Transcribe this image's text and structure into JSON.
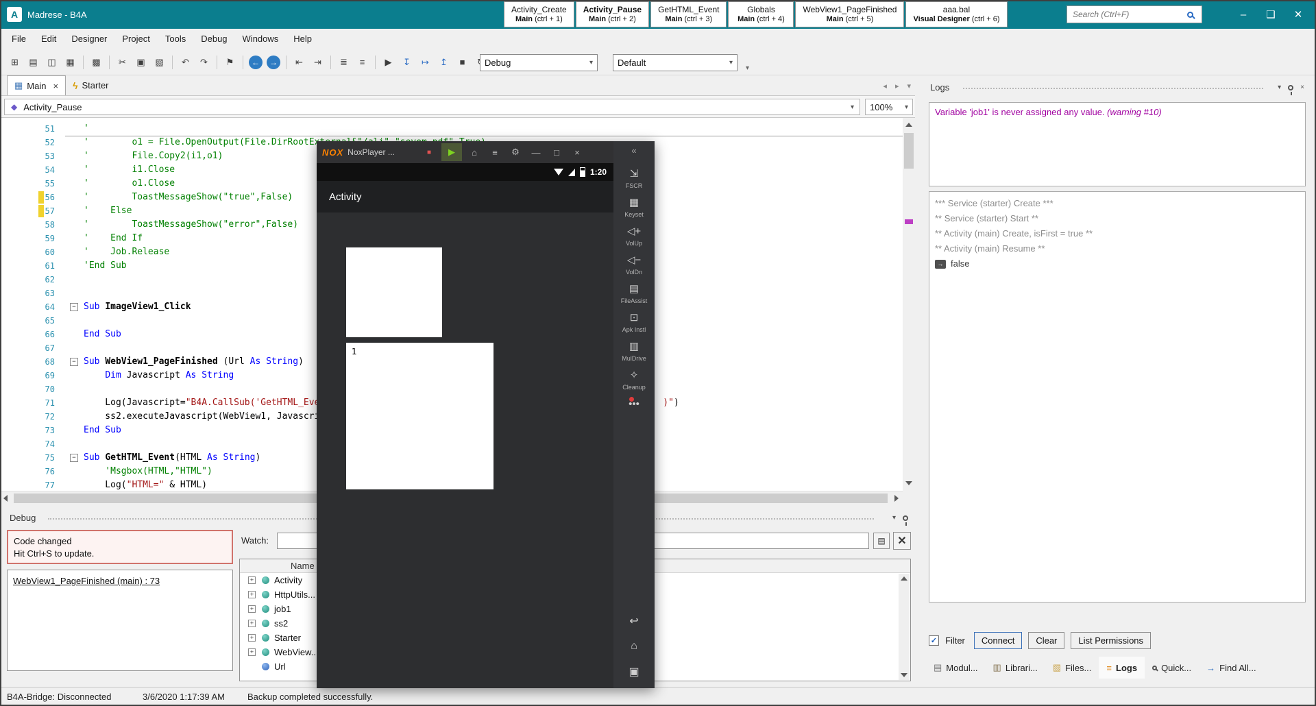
{
  "ui": {
    "collapse_glyph": "▾",
    "close_glyph": "×",
    "check_glyph": "✓",
    "expander_glyph": "+",
    "fold_glyph": "−",
    "return_icon_glyph": "→"
  },
  "app": {
    "title": "Madrese - B4A",
    "logo_letter": "A",
    "accent_color": "#0b7e8e"
  },
  "titlebar": {
    "search_placeholder": "Search (Ctrl+F)",
    "quick_tabs": [
      {
        "title": "Activity_Create",
        "module": "Main",
        "shortcut": "(ctrl + 1)",
        "active": false
      },
      {
        "title": "Activity_Pause",
        "module": "Main",
        "shortcut": "(ctrl + 2)",
        "active": true
      },
      {
        "title": "GetHTML_Event",
        "module": "Main",
        "shortcut": "(ctrl + 3)",
        "active": false
      },
      {
        "title": "Globals",
        "module": "Main",
        "shortcut": "(ctrl + 4)",
        "active": false
      },
      {
        "title": "WebView1_PageFinished",
        "module": "Main",
        "shortcut": "(ctrl + 5)",
        "active": false
      },
      {
        "title": "aaa.bal",
        "module": "Visual Designer",
        "shortcut": "(ctrl + 6)",
        "active": false
      }
    ],
    "window_buttons": [
      {
        "glyph": "–",
        "name": "minimize-button"
      },
      {
        "glyph": "❑",
        "name": "maximize-button"
      },
      {
        "glyph": "✕",
        "name": "close-button"
      }
    ]
  },
  "menubar": [
    "File",
    "Edit",
    "Designer",
    "Project",
    "Tools",
    "Debug",
    "Windows",
    "Help"
  ],
  "toolbar": {
    "debug_mode": "Debug",
    "build_config": "Default",
    "buttons": [
      {
        "glyph": "⊞",
        "name": "new-button"
      },
      {
        "glyph": "▤",
        "name": "open-button"
      },
      {
        "glyph": "◫",
        "name": "save-button"
      },
      {
        "glyph": "▦",
        "name": "save-all-button"
      },
      {
        "sep": true
      },
      {
        "glyph": "▩",
        "name": "designer-button"
      },
      {
        "sep": true
      },
      {
        "glyph": "✂",
        "name": "cut-button"
      },
      {
        "glyph": "▣",
        "name": "copy-button"
      },
      {
        "glyph": "▧",
        "name": "paste-button"
      },
      {
        "sep": true
      },
      {
        "glyph": "↶",
        "name": "undo-button"
      },
      {
        "glyph": "↷",
        "name": "redo-button"
      },
      {
        "sep": true
      },
      {
        "glyph": "⚑",
        "name": "bookmark-button"
      },
      {
        "sep": true
      },
      {
        "glyph": "←",
        "name": "navigate-back-button",
        "style": "circle"
      },
      {
        "glyph": "→",
        "name": "navigate-forward-button",
        "style": "circle"
      },
      {
        "sep": true
      },
      {
        "glyph": "⇤",
        "name": "outdent-button"
      },
      {
        "glyph": "⇥",
        "name": "indent-button"
      },
      {
        "sep": true
      },
      {
        "glyph": "≣",
        "name": "comment-button"
      },
      {
        "glyph": "≡",
        "name": "uncomment-button"
      },
      {
        "sep": true
      },
      {
        "glyph": "▶",
        "name": "run-button"
      },
      {
        "glyph": "↧",
        "name": "step-into-button",
        "style": "blue"
      },
      {
        "glyph": "↦",
        "name": "step-over-button",
        "style": "blue"
      },
      {
        "glyph": "↥",
        "name": "step-out-button",
        "style": "blue"
      },
      {
        "glyph": "■",
        "name": "stop-button"
      },
      {
        "glyph": "↻",
        "name": "restart-button"
      },
      {
        "sep": true
      }
    ]
  },
  "doc_tabs": [
    {
      "label": "Main",
      "active": true,
      "icon_glyph": "▦",
      "icon_class": "grid",
      "icon_name": "module-grid-icon",
      "closable": true
    },
    {
      "label": "Starter",
      "active": false,
      "icon_glyph": "ϟ",
      "icon_class": "bolt",
      "icon_name": "service-lightning-icon",
      "closable": false
    }
  ],
  "doc_tab_nav": [
    {
      "glyph": "◂",
      "name": "tabs-scroll-left"
    },
    {
      "glyph": "▸",
      "name": "tabs-scroll-right"
    },
    {
      "glyph": "▾",
      "name": "tabs-list-dropdown"
    }
  ],
  "module_bar": {
    "selected_sub": "Activity_Pause",
    "zoom": "100%",
    "icon_glyph": "◆"
  },
  "code": {
    "lines": [
      {
        "n": 51,
        "segs": [
          [
            "'",
            "c"
          ]
        ]
      },
      {
        "n": 52,
        "div": true,
        "segs": [
          [
            "'        o1 = File.OpenOutput(File.DirRootExternal&\"/ali\",\"sevom.pdf\",True)",
            "c"
          ]
        ]
      },
      {
        "n": 53,
        "segs": [
          [
            "'        File.Copy2(i1,o1)",
            "c"
          ]
        ]
      },
      {
        "n": 54,
        "segs": [
          [
            "'        i1.Close",
            "c"
          ]
        ]
      },
      {
        "n": 55,
        "segs": [
          [
            "'        o1.Close",
            "c"
          ]
        ]
      },
      {
        "n": 56,
        "mark": true,
        "segs": [
          [
            "'        ToastMessageShow(\"true\",False)",
            "c"
          ]
        ]
      },
      {
        "n": 57,
        "mark": true,
        "segs": [
          [
            "'    Else",
            "c"
          ]
        ]
      },
      {
        "n": 58,
        "segs": [
          [
            "'        ToastMessageShow(\"error\",False)",
            "c"
          ]
        ]
      },
      {
        "n": 59,
        "segs": [
          [
            "'    End If",
            "c"
          ]
        ]
      },
      {
        "n": 60,
        "segs": [
          [
            "'    Job.Release",
            "c"
          ]
        ]
      },
      {
        "n": 61,
        "segs": [
          [
            "'End Sub",
            "c"
          ]
        ]
      },
      {
        "n": 62,
        "segs": []
      },
      {
        "n": 63,
        "segs": []
      },
      {
        "n": 64,
        "fold": true,
        "segs": [
          [
            "Sub ",
            "k"
          ],
          [
            "ImageView1_Click",
            "b"
          ]
        ]
      },
      {
        "n": 65,
        "segs": []
      },
      {
        "n": 66,
        "segs": [
          [
            "End Sub",
            "k"
          ]
        ]
      },
      {
        "n": 67,
        "segs": []
      },
      {
        "n": 68,
        "fold": true,
        "segs": [
          [
            "Sub ",
            "k"
          ],
          [
            "WebView1_PageFinished ",
            "b"
          ],
          [
            "(Url ",
            "p"
          ],
          [
            "As String",
            "k"
          ],
          [
            ")",
            "p"
          ]
        ]
      },
      {
        "n": 69,
        "segs": [
          [
            "    ",
            "p"
          ],
          [
            "Dim ",
            "k"
          ],
          [
            "Javascript ",
            "p"
          ],
          [
            "As String",
            "k"
          ]
        ]
      },
      {
        "n": 70,
        "segs": []
      },
      {
        "n": 71,
        "segs": [
          [
            "    Log(Javascript=",
            "p"
          ],
          [
            "\"B4A.CallSub('GetHTML_Eve",
            "s"
          ],
          [
            "                                                                ",
            "s"
          ],
          [
            ")\"",
            "s"
          ],
          [
            ")",
            "p"
          ]
        ]
      },
      {
        "n": 72,
        "segs": [
          [
            "    ss2.executeJavascript(WebView1, Javascript)",
            "p"
          ]
        ]
      },
      {
        "n": 73,
        "segs": [
          [
            "End Sub",
            "k"
          ]
        ]
      },
      {
        "n": 74,
        "segs": []
      },
      {
        "n": 75,
        "fold": true,
        "segs": [
          [
            "Sub ",
            "k"
          ],
          [
            "GetHTML_Event",
            "b"
          ],
          [
            "(HTML ",
            "p"
          ],
          [
            "As String",
            "k"
          ],
          [
            ")",
            "p"
          ]
        ]
      },
      {
        "n": 76,
        "segs": [
          [
            "    'Msgbox(HTML,\"HTML\")",
            "c"
          ]
        ]
      },
      {
        "n": 77,
        "segs": [
          [
            "    Log(",
            "p"
          ],
          [
            "\"HTML=\"",
            "s"
          ],
          [
            " & HTML)",
            "p"
          ]
        ]
      }
    ]
  },
  "debug_panel": {
    "title": "Debug",
    "notice_line1": "Code changed",
    "notice_line2": "Hit Ctrl+S to update.",
    "stack_entry": "WebView1_PageFinished (main) : 73",
    "watch_label": "Watch:",
    "watch_value": "",
    "table_header": "Name",
    "watch_buttons": [
      {
        "glyph": "▤",
        "name": "watch-copy-button"
      },
      {
        "glyph": "✕",
        "name": "watch-delete-button"
      }
    ],
    "watch_items": [
      {
        "label": "Activity",
        "expand": true,
        "kind": "object"
      },
      {
        "label": "HttpUtils...",
        "expand": true,
        "kind": "object"
      },
      {
        "label": "job1",
        "expand": true,
        "kind": "object"
      },
      {
        "label": "ss2",
        "expand": true,
        "kind": "object"
      },
      {
        "label": "Starter",
        "expand": true,
        "kind": "object"
      },
      {
        "label": "WebView...",
        "expand": true,
        "kind": "object"
      },
      {
        "label": "Url",
        "expand": false,
        "kind": "value"
      }
    ]
  },
  "logs_panel": {
    "title": "Logs",
    "warning_text": "Variable 'job1' is never assigned any value. ",
    "warning_suffix": "(warning #10)",
    "log_lines": [
      "*** Service (starter) Create ***",
      "** Service (starter) Start **",
      "** Activity (main) Create, isFirst = true **",
      "** Activity (main) Resume **"
    ],
    "return_value": "false",
    "filter_label": "Filter",
    "buttons": [
      {
        "label": "Connect",
        "name": "connect-button",
        "primary": true
      },
      {
        "label": "Clear",
        "name": "clear-button"
      },
      {
        "label": "List Permissions",
        "name": "list-permissions-button"
      }
    ],
    "bottom_tabs": [
      {
        "label": "Modul...",
        "glyph": "▤",
        "icon": "modules-icon",
        "active": false
      },
      {
        "label": "Librari...",
        "glyph": "▥",
        "icon": "libraries-icon",
        "active": false
      },
      {
        "label": "Files...",
        "glyph": "▧",
        "icon": "files-icon",
        "active": false
      },
      {
        "label": "Logs",
        "glyph": "≡",
        "icon": "logs-icon",
        "active": true
      },
      {
        "label": "Quick...",
        "glyph": "",
        "icon": "quick-search-icon",
        "active": false
      },
      {
        "label": "Find All...",
        "glyph": "→",
        "icon": "find-all-icon",
        "active": false
      }
    ]
  },
  "statusbar": {
    "bridge": "B4A-Bridge: Disconnected",
    "datetime": "3/6/2020 1:17:39 AM",
    "message": "Backup completed successfully."
  },
  "nox": {
    "logo": "NOX",
    "title": "NoxPlayer ...",
    "time": "1:20",
    "app_title": "Activity",
    "webview_text": "1",
    "collapse_glyph": "«",
    "title_icons": [
      {
        "glyph": "■",
        "name": "record-icon",
        "style": "record"
      },
      {
        "glyph": "▶",
        "name": "play-button",
        "style": "play"
      },
      {
        "glyph": "⌂",
        "name": "home-icon"
      },
      {
        "glyph": "≡",
        "name": "menu-icon"
      },
      {
        "glyph": "⚙",
        "name": "settings-icon"
      },
      {
        "glyph": "—",
        "name": "minimize-icon"
      },
      {
        "glyph": "□",
        "name": "maximize-icon"
      },
      {
        "glyph": "×",
        "name": "close-icon"
      }
    ],
    "sidebar": [
      {
        "glyph": "⇲",
        "label": "FSCR",
        "name": "fullscreen-button"
      },
      {
        "glyph": "▦",
        "label": "Keyset",
        "name": "keyset-button"
      },
      {
        "glyph": "◁+",
        "label": "VolUp",
        "name": "volume-up-button"
      },
      {
        "glyph": "◁−",
        "label": "VolDn",
        "name": "volume-down-button"
      },
      {
        "glyph": "▤",
        "label": "FileAssist",
        "name": "file-assist-button"
      },
      {
        "glyph": "⊡",
        "label": "Apk Instl",
        "name": "apk-install-button"
      },
      {
        "glyph": "▥",
        "label": "MulDrive",
        "name": "multidrive-button"
      },
      {
        "glyph": "✧",
        "label": "Cleanup",
        "name": "cleanup-button"
      },
      {
        "glyph": "•••",
        "label": "",
        "name": "more-button",
        "dot": true
      }
    ],
    "nav": [
      {
        "glyph": "↩",
        "name": "android-back-button"
      },
      {
        "glyph": "⌂",
        "name": "android-home-button"
      },
      {
        "glyph": "▣",
        "name": "android-recents-button"
      }
    ]
  }
}
